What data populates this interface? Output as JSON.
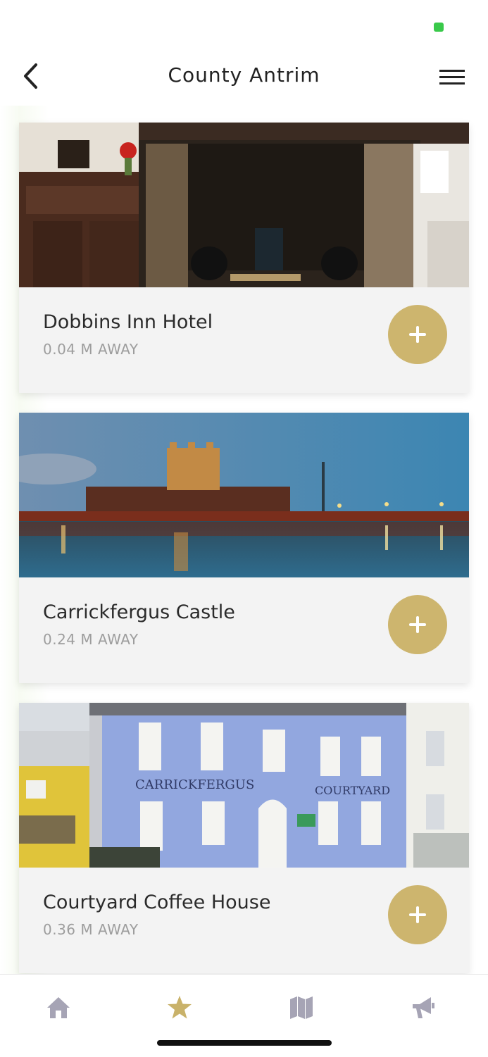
{
  "header": {
    "title": "County Antrim"
  },
  "places": [
    {
      "name": "Dobbins Inn Hotel",
      "distance": "0.04 M AWAY"
    },
    {
      "name": "Carrickfergus Castle",
      "distance": "0.24 M AWAY"
    },
    {
      "name": "Courtyard Coffee House",
      "distance": "0.36 M AWAY"
    }
  ],
  "sign_text": {
    "left": "CARRICKFERGUS",
    "right": "COURTYARD"
  },
  "tabs": [
    {
      "icon": "home-icon",
      "active": false
    },
    {
      "icon": "star-icon",
      "active": true
    },
    {
      "icon": "map-icon",
      "active": false
    },
    {
      "icon": "megaphone-icon",
      "active": false
    }
  ],
  "colors": {
    "accent": "#cdb56e",
    "tab_inactive": "#a6a4b5",
    "tab_active": "#c9b26a",
    "card_bg": "#f3f3f3"
  }
}
